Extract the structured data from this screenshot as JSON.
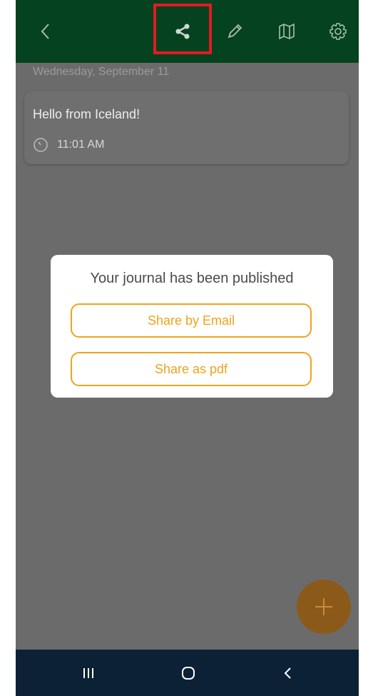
{
  "header": {
    "back_icon": "chevron-left-icon",
    "share_icon": "share-icon",
    "edit_icon": "pencil-icon",
    "map_icon": "map-icon",
    "settings_icon": "gear-icon"
  },
  "journal": {
    "date": "Wednesday, September 11",
    "entries": [
      {
        "title": "Hello from Iceland!",
        "time": "11:01 AM"
      }
    ]
  },
  "dialog": {
    "message": "Your journal has been published",
    "share_email_label": "Share by Email",
    "share_pdf_label": "Share as pdf"
  },
  "colors": {
    "header_bg": "#05421f",
    "accent": "#efa31c",
    "highlight": "#e11b22",
    "nav_bg": "#0c2135"
  }
}
